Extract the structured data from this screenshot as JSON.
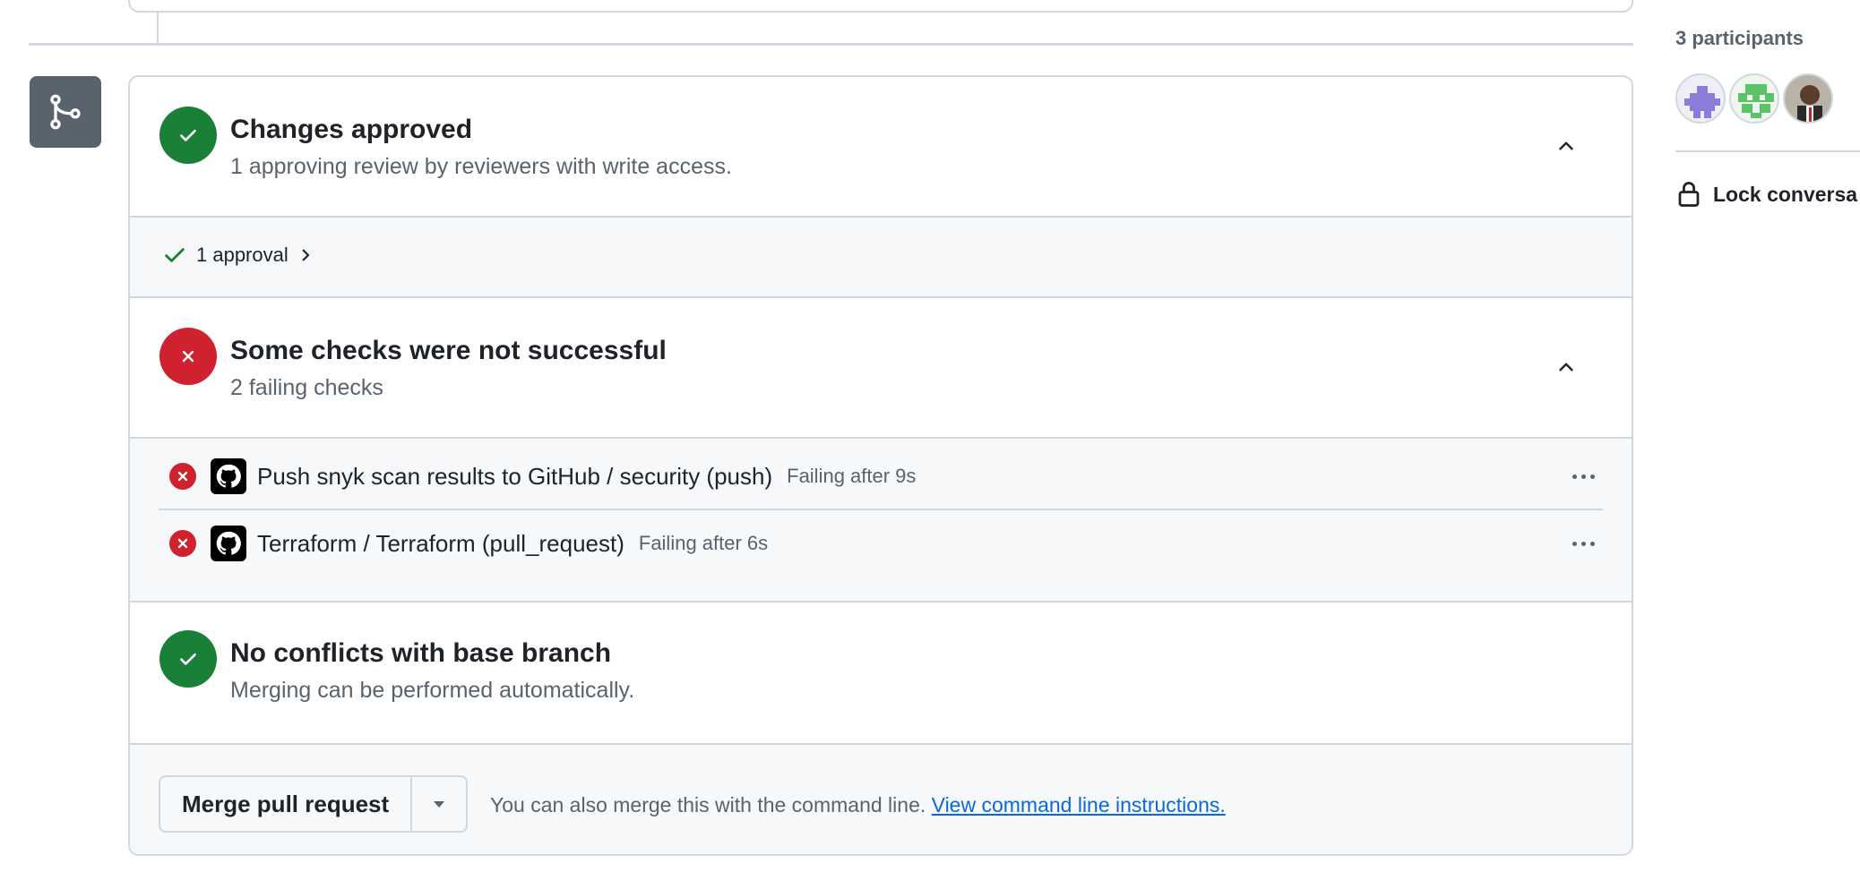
{
  "merge_box": {
    "approved": {
      "title": "Changes approved",
      "subtitle": "1 approving review by reviewers with write access.",
      "approvals_link": "1 approval"
    },
    "checks": {
      "title": "Some checks were not successful",
      "subtitle": "2 failing checks",
      "items": [
        {
          "name": "Push snyk scan results to GitHub / security (push)",
          "status": "Failing after 9s"
        },
        {
          "name": "Terraform / Terraform (pull_request)",
          "status": "Failing after 6s"
        }
      ]
    },
    "conflicts": {
      "title": "No conflicts with base branch",
      "subtitle": "Merging can be performed automatically."
    },
    "merge": {
      "button_label": "Merge pull request",
      "note": "You can also merge this with the command line.",
      "link": "View command line instructions."
    }
  },
  "sidebar": {
    "participants_label": "3 participants",
    "participants": [
      "avatar-purple-identicon",
      "avatar-green-identicon",
      "avatar-photo"
    ],
    "lock_label": "Lock conversa"
  },
  "colors": {
    "success": "#1a7f37",
    "danger": "#cf222e",
    "muted": "#59636e",
    "border": "#d0d7de",
    "link": "#0969da",
    "subtle_bg": "#f6f8fa"
  },
  "icons": [
    "git-merge-icon",
    "check-circle-icon",
    "x-circle-icon",
    "chevron-up-icon",
    "check-icon",
    "chevron-right-icon",
    "github-logo-icon",
    "kebab-icon",
    "triangle-down-icon",
    "lock-icon"
  ]
}
